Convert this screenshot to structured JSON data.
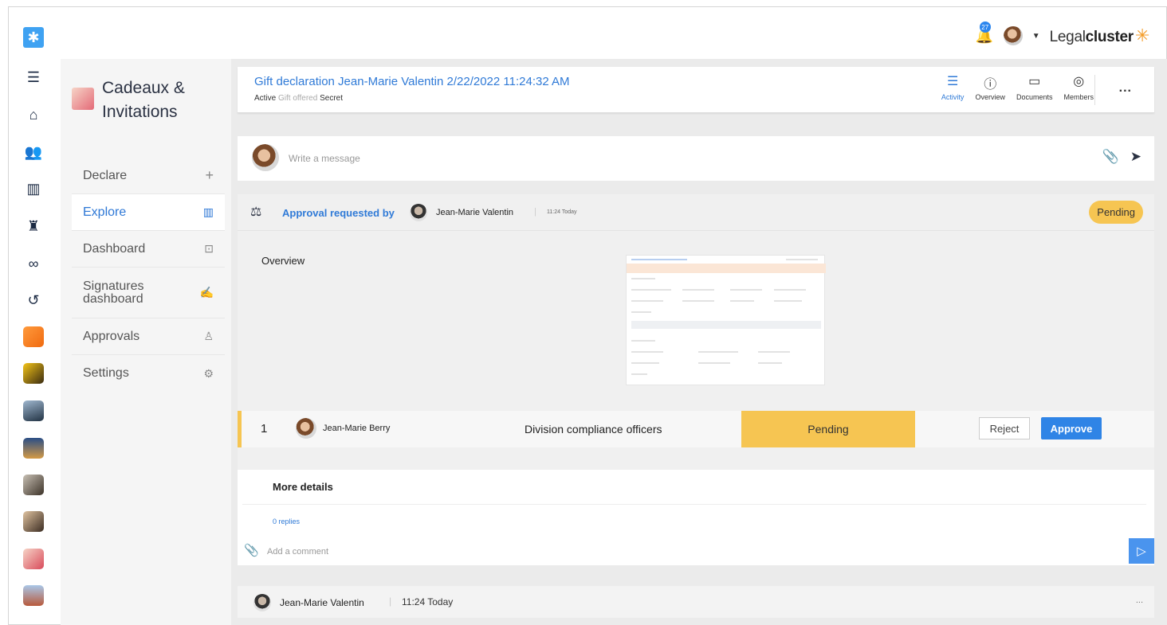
{
  "rail": {
    "icons": [
      "app-logo-icon",
      "filter-icon",
      "home-icon",
      "users-icon",
      "building-icon",
      "stamp-icon",
      "link-icon",
      "history-icon",
      "orange-app-icon",
      "yellow-app-icon",
      "mountain-app-icon",
      "city-app-icon",
      "gavel-app-icon",
      "handshake-app-icon",
      "gift-app-icon",
      "landscape-app-icon"
    ]
  },
  "topbar": {
    "notifications_count": "27",
    "brand_light": "Legal",
    "brand_bold": "cluster"
  },
  "module": {
    "title_line1": "Cadeaux &",
    "title_line2": "Invitations",
    "nav": [
      {
        "label": "Declare",
        "icon": "plus-icon"
      },
      {
        "label": "Explore",
        "icon": "books-icon"
      },
      {
        "label": "Dashboard",
        "icon": "chart-icon"
      },
      {
        "label_line1": "Signatures",
        "label_line2": "dashboard",
        "icon": "signature-icon"
      },
      {
        "label": "Approvals",
        "icon": "stamp-icon"
      },
      {
        "label": "Settings",
        "icon": "gear-icon"
      }
    ]
  },
  "header": {
    "title": "Gift declaration Jean-Marie Valentin 2/22/2022 11:24:32 AM",
    "tag_active": "Active",
    "tag_gift": "Gift offered",
    "tag_secret": "Secret",
    "tabs": [
      {
        "label": "Activity",
        "active": true
      },
      {
        "label": "Overview",
        "active": false
      },
      {
        "label": "Documents",
        "active": false
      },
      {
        "label": "Members",
        "active": false
      }
    ],
    "more": "..."
  },
  "message": {
    "placeholder": "Write a message"
  },
  "approval": {
    "label": "Approval requested by",
    "requester": "Jean-Marie Valentin",
    "separator": "|",
    "time": "11:24 Today",
    "status": "Pending",
    "overview_label": "Overview",
    "step": {
      "number": "1",
      "approver": "Jean-Marie Berry",
      "group": "Division compliance officers",
      "status": "Pending",
      "reject_label": "Reject",
      "approve_label": "Approve"
    }
  },
  "details": {
    "title": "More details",
    "replies": "0 replies",
    "comment_placeholder": "Add a comment"
  },
  "footer_entry": {
    "name": "Jean-Marie Valentin",
    "separator": "|",
    "time": "11:24 Today",
    "more": "..."
  },
  "colors": {
    "accent": "#2f7ad7",
    "pending": "#f6c552",
    "approve": "#2f84e6"
  }
}
